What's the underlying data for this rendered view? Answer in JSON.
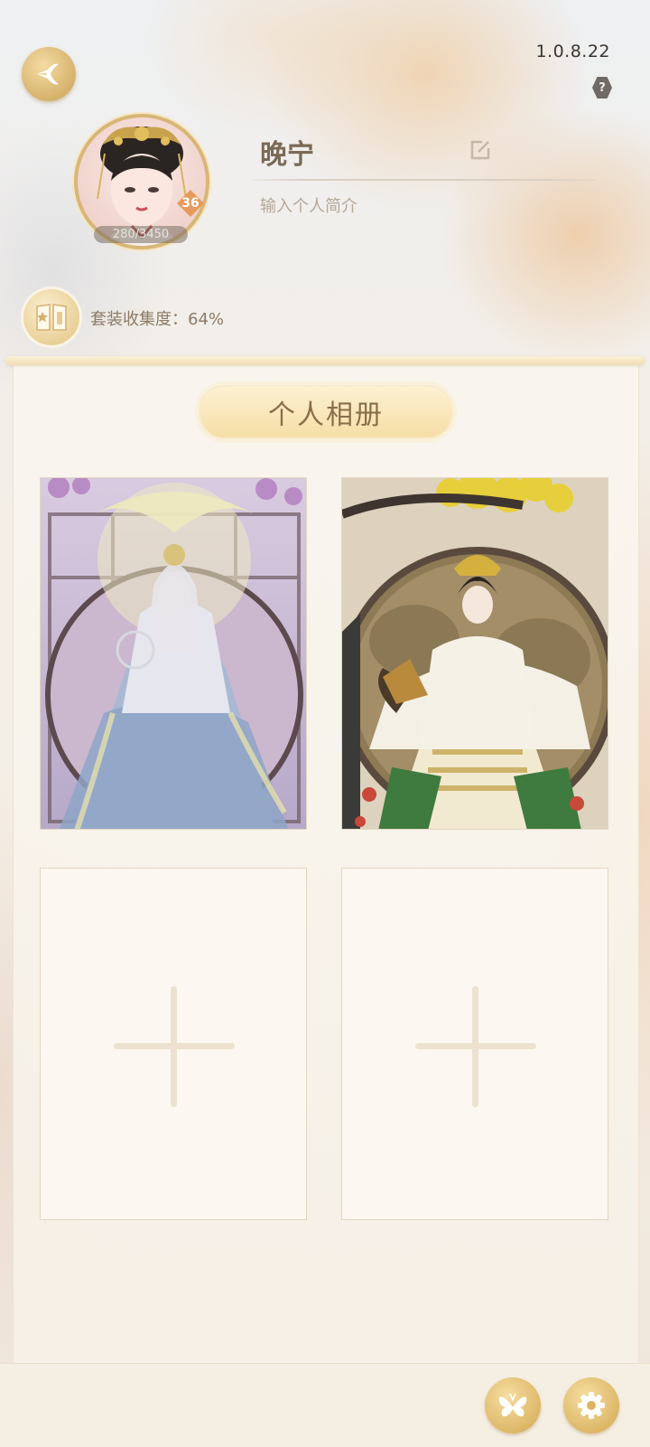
{
  "header": {
    "version": "1.0.8.22",
    "help_label": "?"
  },
  "profile": {
    "nickname": "晚宁",
    "bio_placeholder": "输入个人简介",
    "level": "36",
    "exp": "280/3450"
  },
  "collection": {
    "label": "套装收集度：64%"
  },
  "album": {
    "title": "个人相册",
    "slots": [
      {
        "state": "filled"
      },
      {
        "state": "filled"
      },
      {
        "state": "empty"
      },
      {
        "state": "empty"
      }
    ]
  },
  "colors": {
    "accent_gold": "#d6b26b",
    "text_brown": "#8c7b66",
    "panel_bg": "#f8f3ea"
  },
  "icons": {
    "back": "back-icon",
    "edit": "edit-icon",
    "collection": "collection-book-icon",
    "butterfly": "butterfly-icon",
    "settings": "gear-icon"
  }
}
